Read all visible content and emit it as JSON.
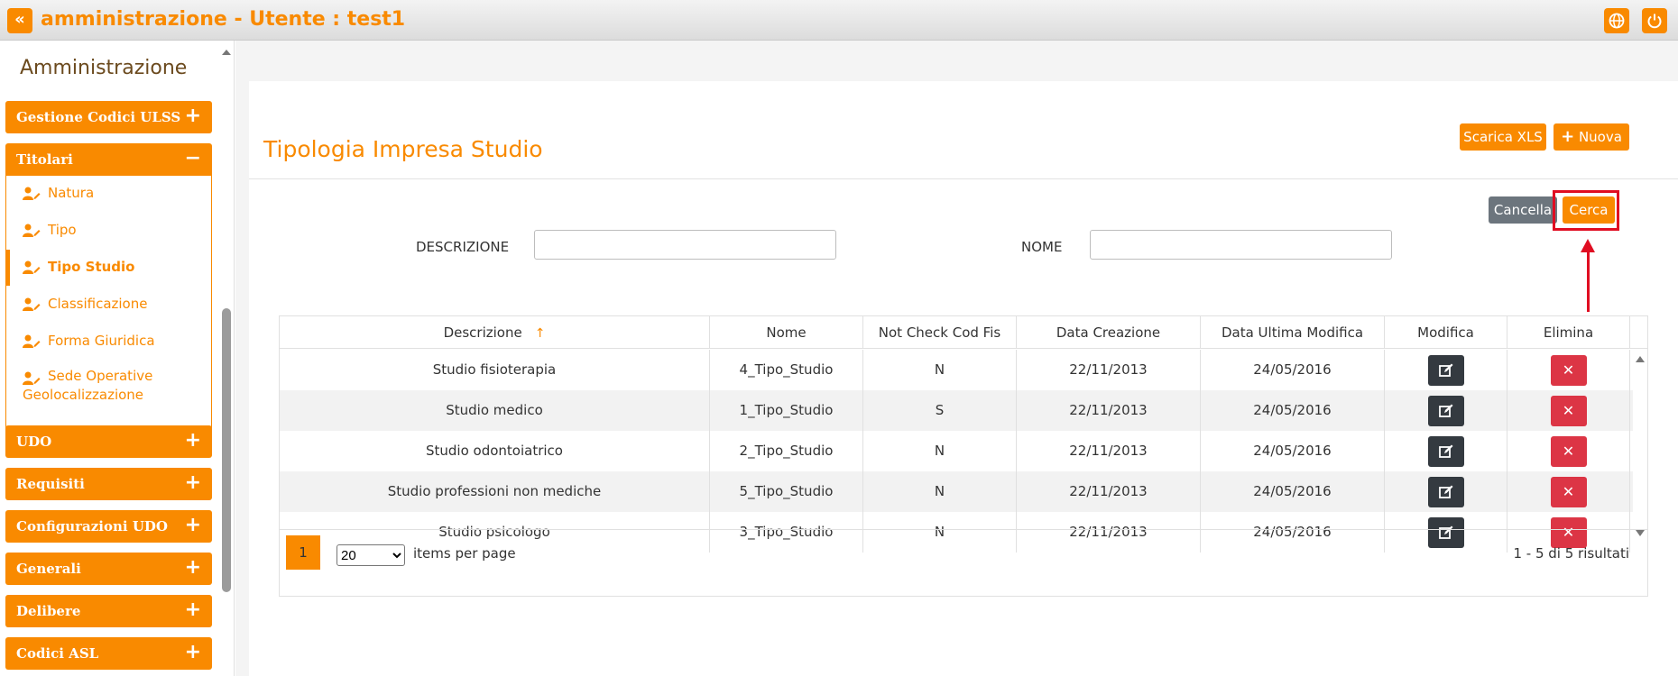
{
  "header": {
    "back_icon": "double-chevron-left-icon",
    "title": "amministrazione - Utente : test1",
    "language_icon": "globe-icon",
    "power_icon": "power-icon"
  },
  "sidebar": {
    "title": "Amministrazione",
    "sections": [
      {
        "label": "Gestione Codici ULSS",
        "sign": "+"
      },
      {
        "label": "Titolari",
        "sign": "−"
      },
      {
        "label": "UDO",
        "sign": "+"
      },
      {
        "label": "Requisiti",
        "sign": "+"
      },
      {
        "label": "Configurazioni UDO",
        "sign": "+"
      },
      {
        "label": "Generali",
        "sign": "+"
      },
      {
        "label": "Delibere",
        "sign": "+"
      },
      {
        "label": "Codici ASL",
        "sign": "+"
      }
    ],
    "titolari_items": [
      {
        "label": "Natura"
      },
      {
        "label": "Tipo"
      },
      {
        "label": "Tipo Studio"
      },
      {
        "label": "Classificazione"
      },
      {
        "label": "Forma Giuridica"
      },
      {
        "label": "Sede Operative",
        "label2": "Geolocalizzazione"
      }
    ]
  },
  "main": {
    "page_title": "Tipologia Impresa Studio",
    "download_xls_label": "Scarica XLS",
    "new_label": "Nuova",
    "clear_label": "Cancella",
    "search_label": "Cerca",
    "filters": {
      "descrizione_label": "DESCRIZIONE",
      "descrizione_value": "",
      "nome_label": "NOME",
      "nome_value": ""
    }
  },
  "grid": {
    "columns": [
      "Descrizione",
      "Nome",
      "Not Check Cod Fis",
      "Data Creazione",
      "Data Ultima Modifica",
      "Modifica",
      "Elimina"
    ],
    "sort_indicator": "↑",
    "rows": [
      {
        "descrizione": "Studio fisioterapia",
        "nome": "4_Tipo_Studio",
        "not_check": "N",
        "creazione": "22/11/2013",
        "modifica": "24/05/2016"
      },
      {
        "descrizione": "Studio medico",
        "nome": "1_Tipo_Studio",
        "not_check": "S",
        "creazione": "22/11/2013",
        "modifica": "24/05/2016"
      },
      {
        "descrizione": "Studio odontoiatrico",
        "nome": "2_Tipo_Studio",
        "not_check": "N",
        "creazione": "22/11/2013",
        "modifica": "24/05/2016"
      },
      {
        "descrizione": "Studio professioni non mediche",
        "nome": "5_Tipo_Studio",
        "not_check": "N",
        "creazione": "22/11/2013",
        "modifica": "24/05/2016"
      },
      {
        "descrizione": "Studio psicologo",
        "nome": "3_Tipo_Studio",
        "not_check": "N",
        "creazione": "22/11/2013",
        "modifica": "24/05/2016"
      }
    ],
    "delete_glyph": "✕",
    "pager": {
      "current_page": "1",
      "page_size": "20",
      "items_per_page_label": "items per page",
      "count_text": "1 - 5 di 5 risultati"
    }
  },
  "colors": {
    "accent": "#f98a00",
    "edit_button": "#343a40",
    "delete_button": "#dc3545",
    "highlight": "#e00d22"
  }
}
